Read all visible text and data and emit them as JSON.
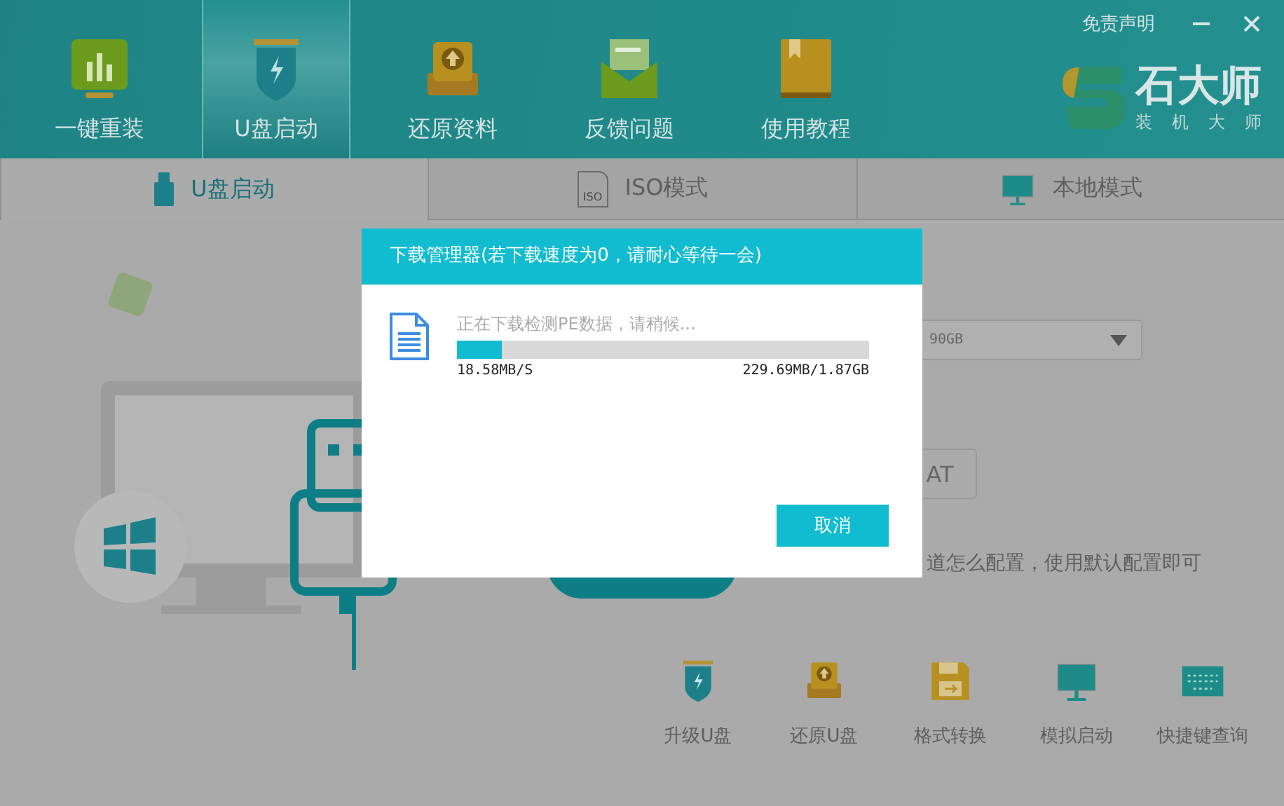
{
  "header": {
    "nav": [
      {
        "label": "一键重装",
        "kind": "chart",
        "selected": false
      },
      {
        "label": "U盘启动",
        "kind": "usb",
        "selected": true
      },
      {
        "label": "还原资料",
        "kind": "restore",
        "selected": false
      },
      {
        "label": "反馈问题",
        "kind": "mail",
        "selected": false
      },
      {
        "label": "使用教程",
        "kind": "book",
        "selected": false
      }
    ],
    "disclaimer": "免责声明",
    "logo": {
      "name": "石大师",
      "tagline": "装机大师"
    }
  },
  "mode_tabs": [
    {
      "label": "U盘启动",
      "kind": "usb",
      "selected": true
    },
    {
      "label": "ISO模式",
      "kind": "iso",
      "icon_text": "ISO",
      "selected": false
    },
    {
      "label": "本地模式",
      "kind": "monitor",
      "selected": false
    }
  ],
  "background": {
    "device_select": "90GB",
    "format_button": "AT",
    "hint": "道怎么配置，使用默认配置即可"
  },
  "tools": [
    {
      "label": "升级U盘",
      "kind": "usb"
    },
    {
      "label": "还原U盘",
      "kind": "restore"
    },
    {
      "label": "格式转换",
      "kind": "floppy"
    },
    {
      "label": "模拟启动",
      "kind": "monitor"
    },
    {
      "label": "快捷键查询",
      "kind": "keyboard"
    }
  ],
  "dialog": {
    "title": "下载管理器(若下载速度为0，请耐心等待一会)",
    "status": "正在下载检测PE数据，请稍候...",
    "level": 0.11,
    "speed": "18.58MB/S",
    "progress_text": "229.69MB/1.87GB",
    "cancel": "取消"
  }
}
